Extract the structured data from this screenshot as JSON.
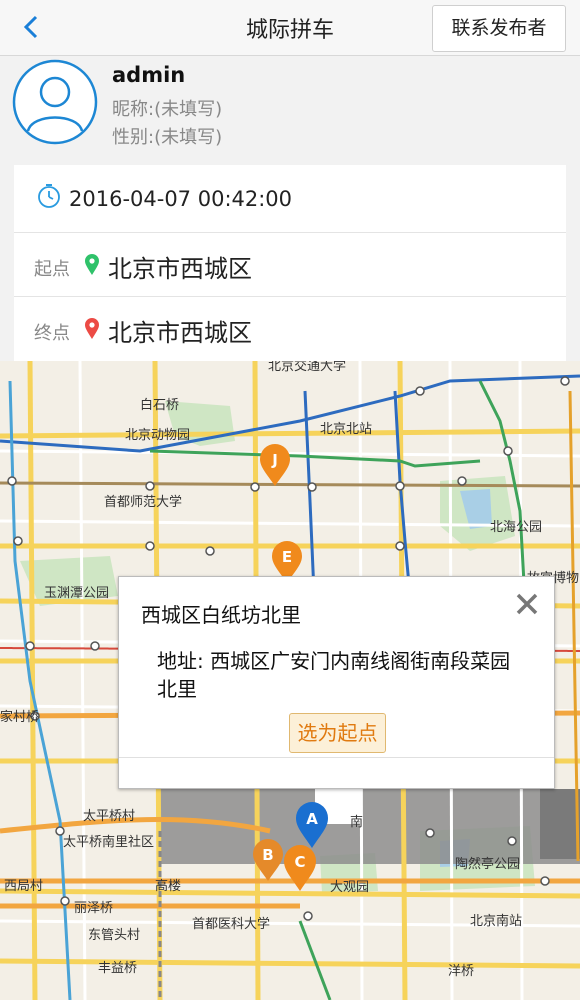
{
  "header": {
    "title": "城际拼车",
    "contact_label": "联系发布者"
  },
  "profile": {
    "username": "admin",
    "nickname": "昵称:(未填写)",
    "gender": "性别:(未填写)"
  },
  "trip": {
    "datetime": "2016-04-07 00:42:00",
    "start_label": "起点",
    "start_place": "北京市西城区",
    "end_label": "终点",
    "end_place": "北京市西城区"
  },
  "map": {
    "labels": {
      "bjjt": "北京交通大学",
      "baishiqiao": "白石桥",
      "zoo": "北京动物园",
      "north_station": "北京北站",
      "capital_normal": "首都师范大学",
      "beihai": "北海公园",
      "yuyuantan": "玉渊潭公园",
      "museum": "故宫博物",
      "jiajiaqiao": "家村桥",
      "taipingqiao": "太平桥村",
      "taipingqiao_south": "太平桥南里社区",
      "xijucun": "西局村",
      "gaolou": "高楼",
      "lizeqiao": "丽泽桥",
      "dongguantoucun": "东管头村",
      "fengyiqiao": "丰益桥",
      "capital_medical": "首都医科大学",
      "daguanyuan": "大观园",
      "taoranting": "陶然亭公园",
      "south_station": "北京南站",
      "yangqiao": "洋桥",
      "nan": "南"
    },
    "markers": [
      "J",
      "E",
      "A",
      "B",
      "C"
    ],
    "colors": {
      "orange_marker": "#f08a1c",
      "blue_marker": "#1a6fd0",
      "subway_blue": "#2d6bbf",
      "subway_green": "#3ea35a",
      "road_yellow": "#f6d35b",
      "beltway": "#a58a5a"
    }
  },
  "popup": {
    "title": "西城区白纸坊北里",
    "address": "地址: 西城区广安门内南线阁街南段菜园北里",
    "select_label": "选为起点"
  }
}
